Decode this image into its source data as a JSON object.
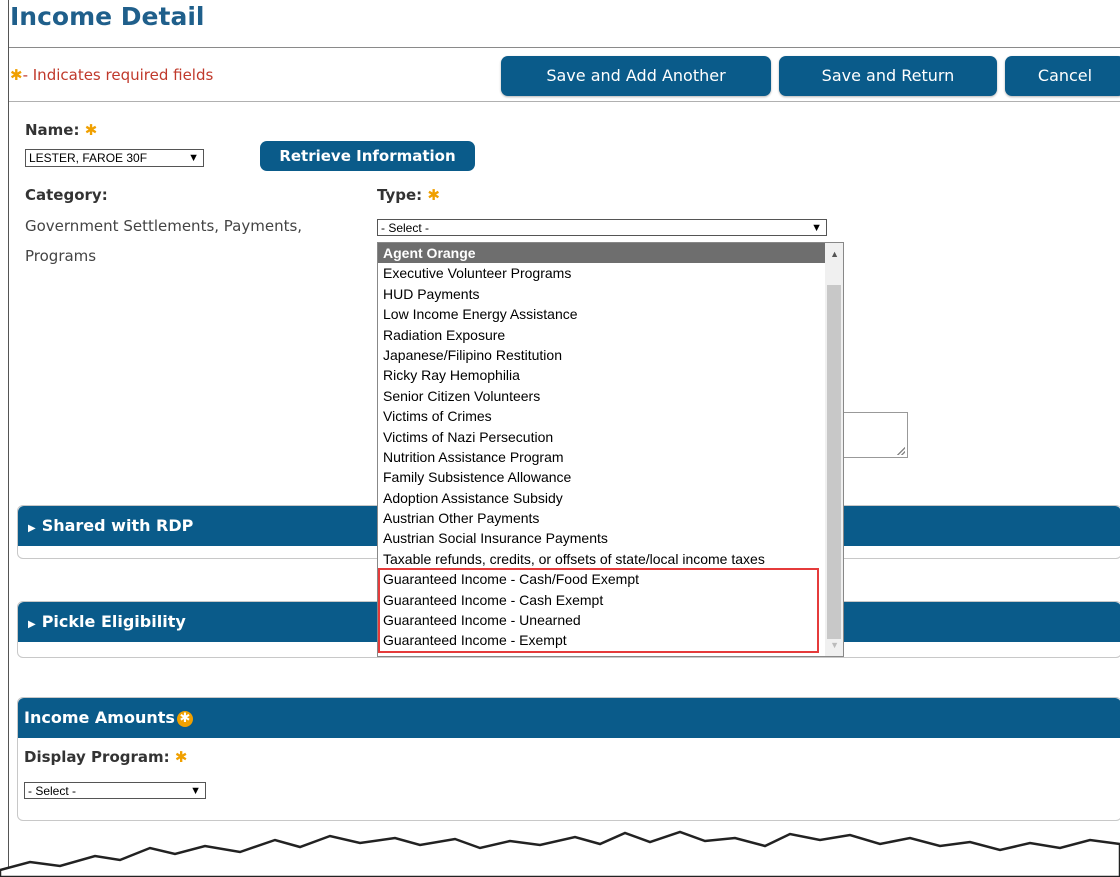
{
  "page": {
    "title": "Income Detail",
    "required_note": "- Indicates required fields",
    "required_star": "✱"
  },
  "toolbar": {
    "save_add_label": "Save and Add Another",
    "save_return_label": "Save and Return",
    "cancel_label": "Cancel"
  },
  "form": {
    "name_label": "Name:",
    "name_value": "LESTER, FAROE 30F",
    "retrieve_label": "Retrieve Information",
    "category_label": "Category:",
    "category_value": "Government Settlements, Payments, Programs",
    "type_label": "Type:",
    "type_value": "- Select -",
    "type_options": [
      "Agent Orange",
      "Executive Volunteer Programs",
      "HUD Payments",
      "Low Income Energy Assistance",
      "Radiation Exposure",
      "Japanese/Filipino Restitution",
      "Ricky Ray Hemophilia",
      "Senior Citizen Volunteers",
      "Victims of Crimes",
      "Victims of Nazi Persecution",
      "Nutrition Assistance Program",
      "Family Subsistence Allowance",
      "Adoption Assistance Subsidy",
      "Austrian Other Payments",
      "Austrian Social Insurance Payments",
      "Taxable refunds, credits, or offsets of state/local income taxes",
      "Guaranteed Income - Cash/Food Exempt",
      "Guaranteed Income - Cash Exempt",
      "Guaranteed Income - Unearned",
      "Guaranteed Income - Exempt"
    ]
  },
  "panels": {
    "rdp_title": "Shared with RDP",
    "pickle_title": "Pickle Eligibility",
    "income_title": "Income Amounts",
    "display_program_label": "Display Program:",
    "display_program_value": "- Select -"
  },
  "colors": {
    "accent": "#0a5b8a",
    "title": "#1f5f8b",
    "required": "#c0392b",
    "star": "#f0a000",
    "highlight": "#e53b3b"
  }
}
